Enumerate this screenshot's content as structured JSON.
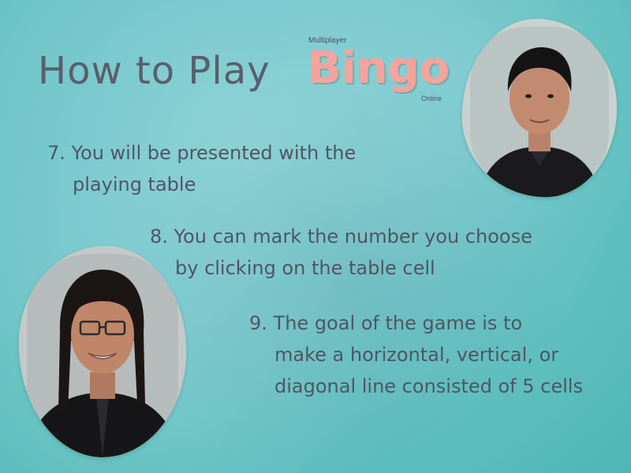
{
  "title": {
    "prefix": "How to Play",
    "bingo": "Bingo",
    "tag_top": "Multiplayer",
    "tag_bottom": "Online"
  },
  "steps": [
    {
      "number": "7.",
      "line1": "You will be presented with the",
      "line2": "playing table"
    },
    {
      "number": "8.",
      "line1": "You can mark the number you choose",
      "line2": "by clicking on the table cell"
    },
    {
      "number": "9.",
      "line1": "The goal of the game is to",
      "line2a": "make a horizontal, vertical, or",
      "line2b": "diagonal line consisted of 5 cells"
    }
  ],
  "colors": {
    "background": "#78c9ce",
    "title_text": "#5a5f6b",
    "bingo_accent": "#f6a39c",
    "body_text": "#4f5563",
    "photo_border": "#f7f1dd"
  }
}
